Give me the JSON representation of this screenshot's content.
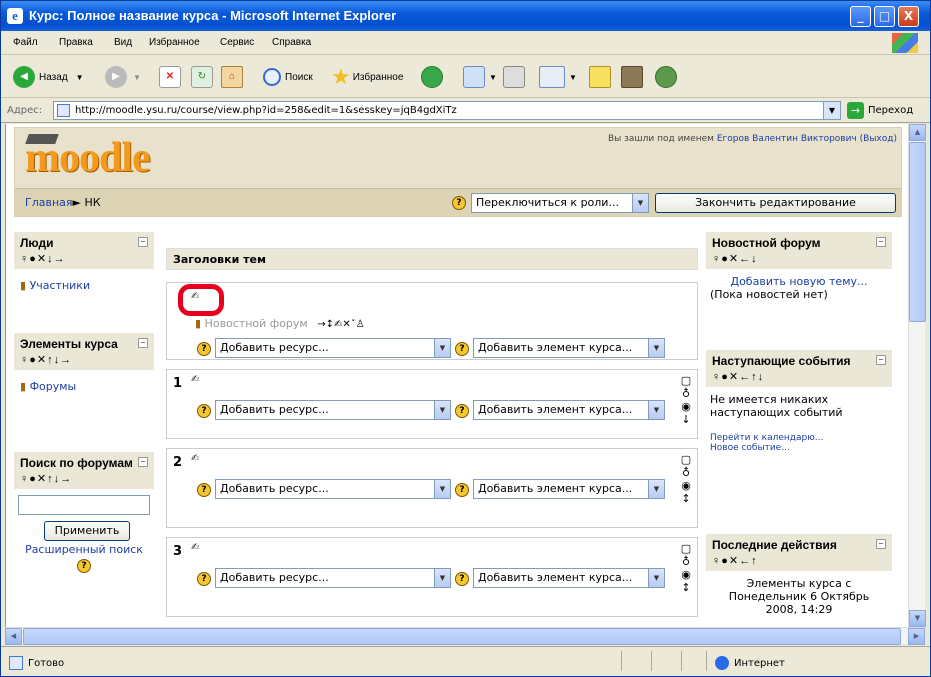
{
  "window": {
    "title": "Курс: Полное название курса - Microsoft Internet Explorer",
    "controls": [
      "_",
      "□",
      "X"
    ]
  },
  "menu": [
    "Файл",
    "Правка",
    "Вид",
    "Избранное",
    "Сервис",
    "Справка"
  ],
  "toolbar": {
    "back": "Назад",
    "search": "Поиск",
    "favorites": "Избранное"
  },
  "address": {
    "label": "Адрес:",
    "url": "http://moodle.ysu.ru/course/view.php?id=258&edit=1&sesskey=jqB4gdXiTz",
    "go": "Переход"
  },
  "header": {
    "logo": "moodle",
    "login_prefix": "Вы зашли под именем",
    "user": "Егоров Валентин Викторович",
    "logout": "(Выход)",
    "breadcrumb_home": "Главная",
    "breadcrumb_sep": "►",
    "breadcrumb_course": "НК",
    "role_select": "Переключиться к роли...",
    "end_edit": "Закончить редактирование"
  },
  "left": {
    "people": {
      "title": "Люди",
      "link": "Участники"
    },
    "activities": {
      "title": "Элементы курса",
      "link": "Форумы"
    },
    "search": {
      "title": "Поиск по форумам",
      "apply": "Применить",
      "advanced": "Расширенный поиск"
    }
  },
  "main": {
    "header": "Заголовки тем",
    "news_forum": "Новостной форум",
    "add_resource": "Добавить ресурс...",
    "add_activity": "Добавить элемент курса...",
    "topics": [
      "1",
      "2",
      "3"
    ]
  },
  "right": {
    "news": {
      "title": "Новостной форум",
      "add": "Добавить новую тему...",
      "none": "(Пока новостей нет)"
    },
    "events": {
      "title": "Наступающие события",
      "none": "Не имеется никаких наступающих событий",
      "calendar": "Перейти к календарю...",
      "new_event": "Новое событие..."
    },
    "recent": {
      "title": "Последние действия",
      "text": "Элементы курса с Понедельник 6 Октябрь 2008, 14:29"
    }
  },
  "status": {
    "done": "Готово",
    "zone": "Интернет"
  },
  "icons": {
    "block_controls": "♀●✕↓→",
    "block_controls2": "♀●✕↑↓→",
    "block_controls3": "♀●✕←↓",
    "block_controls4": "♀●✕←↑↓",
    "block_controls5": "♀●✕←↑",
    "news_item_controls": "→↕✍✕ˇ♙"
  }
}
